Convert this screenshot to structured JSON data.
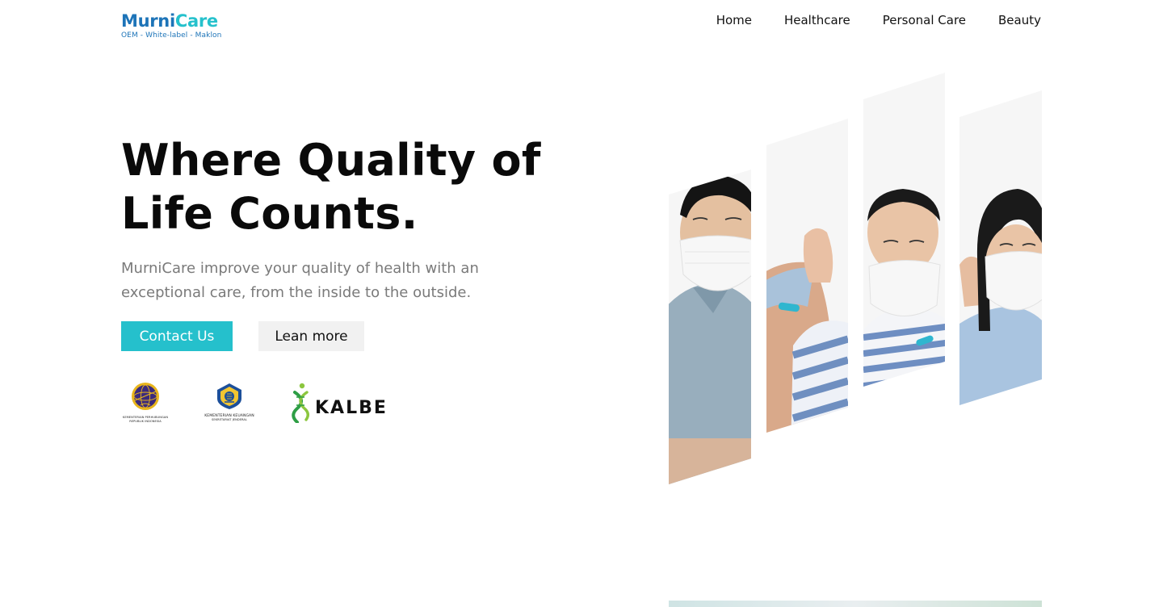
{
  "brand": {
    "name_part1": "Murni",
    "name_part2": "Care",
    "tagline": "OEM - White-label - Maklon",
    "primary_color": "#1d74b8",
    "accent_color": "#25c1cc"
  },
  "nav": {
    "items": [
      {
        "label": "Home"
      },
      {
        "label": "Healthcare"
      },
      {
        "label": "Personal Care"
      },
      {
        "label": "Beauty"
      }
    ]
  },
  "hero": {
    "title_line1": "Where Quality of",
    "title_line2": "Life Counts.",
    "subtitle": "MurniCare improve your quality of health with an exceptional care, from the inside to the outside.",
    "primary_button": "Contact Us",
    "secondary_button": "Lean more",
    "button_color": "#25c0cc"
  },
  "partners": [
    {
      "icon": "ministry-of-transportation-emblem",
      "caption_line1": "KEMENTERIAN PERHUBUNGAN",
      "caption_line2": "REPUBLIK INDONESIA"
    },
    {
      "icon": "ministry-of-finance-emblem",
      "caption_line1": "KEMENTERIAN KEUANGAN",
      "caption_line2": "SEKRETARIAT JENDERAL"
    },
    {
      "icon": "kalbe-logo",
      "caption_line1": "KALBE"
    }
  ],
  "hero_image": {
    "icon": "family-wearing-masks-photo"
  }
}
